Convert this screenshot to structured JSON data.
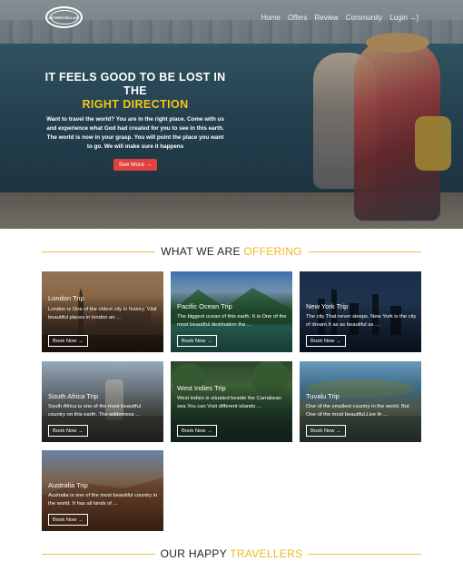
{
  "nav": {
    "logo_text": "INTERSTELLAR",
    "items": [
      "Home",
      "Offers",
      "Review",
      "Community",
      "Login"
    ],
    "login_icon": "login-icon"
  },
  "hero": {
    "title_line1": "IT FEELS GOOD TO BE LOST IN THE",
    "title_line2": "RIGHT DIRECTION",
    "description": "Want to travel the world? You are in the right place. Come with us and experience what God had created for you to see in this earth. The world is now in your grasp. You will point the place you want to go. We will make sure it happens",
    "button_label": "See More",
    "button_icon": "arrow-right-icon",
    "accent_color": "#f5c518",
    "button_color": "#e0413e"
  },
  "offering": {
    "heading_main": "WHAT WE ARE",
    "heading_highlight": "OFFERING",
    "cards": [
      {
        "title": "London Trip",
        "desc": "London is One of the oldest city in history. Visit beautiful places in london an ...",
        "book": "Book Now"
      },
      {
        "title": "Pacific Ocean Trip",
        "desc": "The biggest ocean of this earth. It is One of the most beautiful destination tha ...",
        "book": "Book Now"
      },
      {
        "title": "New York Trip",
        "desc": "The city That never sleeps. New York is the city of dream.It as as beautiful as ...",
        "book": "Book Now"
      },
      {
        "title": "South Africa Trip",
        "desc": "South Africa is one of the most beautiful country on this earth. The wilderness ...",
        "book": "Book Now"
      },
      {
        "title": "West Indies Trip",
        "desc": "West indies is situated beside the Carrabean sea.You can Visit different islands ...",
        "book": "Book Now"
      },
      {
        "title": "Tuvalu Trip",
        "desc": "One of the smallest country in the world. But One of the most beautiful.Live th ...",
        "book": "Book Now"
      },
      {
        "title": "Australia Trip",
        "desc": "Australia is one of the most beautiful country in the world. It has all kinds of ...",
        "book": "Book Now"
      }
    ]
  },
  "travellers": {
    "heading_main": "OUR HAPPY",
    "heading_highlight": "TRAVELLERS"
  },
  "colors": {
    "highlight": "#f0b81c",
    "heading_line": "#e7c14a"
  }
}
